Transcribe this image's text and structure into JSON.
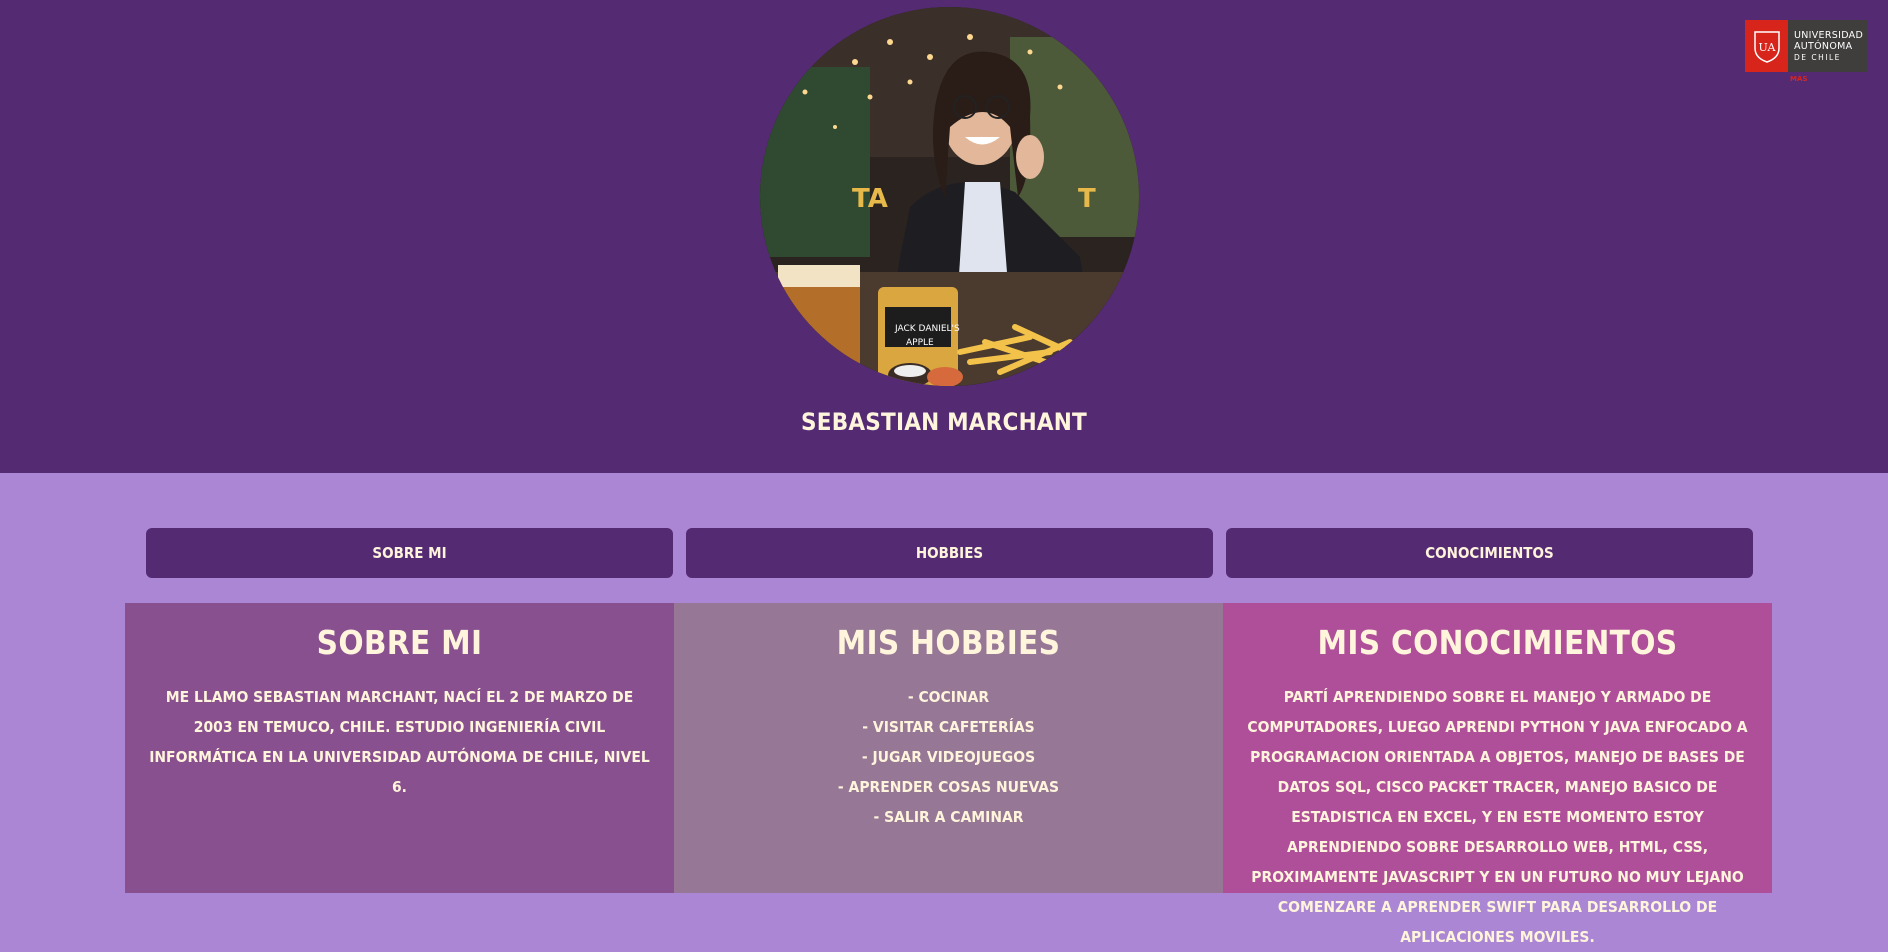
{
  "profile": {
    "name": "SEBASTIAN MARCHANT"
  },
  "logo": {
    "lines": [
      "UNIVERSIDAD",
      "AUTÓNOMA",
      "DE CHILE"
    ],
    "badge": "UA",
    "tag": "MÁS"
  },
  "nav": {
    "tabs": [
      {
        "label": "SOBRE MI"
      },
      {
        "label": "HOBBIES"
      },
      {
        "label": "CONOCIMIENTOS"
      }
    ]
  },
  "sections": {
    "about": {
      "title": "SOBRE MI",
      "text": "ME LLAMO SEBASTIAN MARCHANT, NACÍ EL 2 DE MARZO DE 2003 EN TEMUCO, CHILE. ESTUDIO INGENIERÍA CIVIL INFORMÁTICA EN LA UNIVERSIDAD AUTÓNOMA DE CHILE, NIVEL 6."
    },
    "hobbies": {
      "title": "MIS HOBBIES",
      "items": [
        "- COCINAR",
        "- VISITAR CAFETERÍAS",
        "- JUGAR VIDEOJUEGOS",
        "- APRENDER COSAS NUEVAS",
        "- SALIR A CAMINAR"
      ]
    },
    "skills": {
      "title": "MIS CONOCIMIENTOS",
      "text": "PARTÍ APRENDIENDO SOBRE EL MANEJO Y ARMADO DE COMPUTADORES, LUEGO APRENDI PYTHON Y JAVA ENFOCADO A PROGRAMACION ORIENTADA A OBJETOS, MANEJO DE BASES DE DATOS SQL, CISCO PACKET TRACER, MANEJO BASICO DE ESTADISTICA EN EXCEL, Y EN ESTE MOMENTO ESTOY APRENDIENDO SOBRE DESARROLLO WEB, HTML, CSS, PROXIMAMENTE JAVASCRIPT Y EN UN FUTURO NO MUY LEJANO COMENZARE A APRENDER SWIFT PARA DESARROLLO DE APLICACIONES MOVILES."
    }
  },
  "colors": {
    "header_bg": "#542a73",
    "page_bg": "#ab86d4",
    "tab_bg": "#542a73",
    "about_bg": "#88508f",
    "hobbies_bg": "#967795",
    "skills_bg": "#b04f99",
    "text": "#fff4dc",
    "logo_red": "#d8251c"
  }
}
